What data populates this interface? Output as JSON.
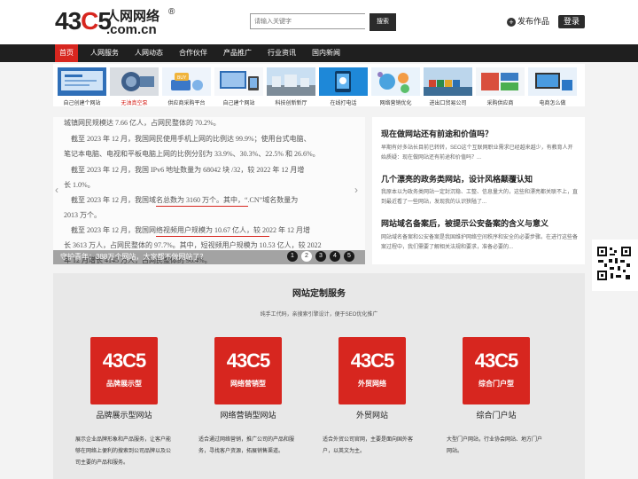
{
  "header": {
    "logo_digits": "43",
    "logo_mid": "C",
    "logo_end": "5",
    "logo_cn": "人网网络",
    "logo_domain": ".com.cn",
    "logo_reg": "®",
    "search_placeholder": "请输入关键字",
    "search_button": "搜索",
    "publish_label": "发布作品",
    "login_label": "登录"
  },
  "nav": [
    "首页",
    "人网服务",
    "人网动态",
    "合作伙伴",
    "产品推广",
    "行业资讯",
    "国内新闻"
  ],
  "thumbs": [
    {
      "caption": "自己创建个网站",
      "red": false
    },
    {
      "caption": "无油真空泵",
      "red": true
    },
    {
      "caption": "供应商采购平台",
      "red": false
    },
    {
      "caption": "自己建个网站",
      "red": false
    },
    {
      "caption": "科技创新新厅",
      "red": false
    },
    {
      "caption": "在线打电话",
      "red": false
    },
    {
      "caption": "网络营销优化",
      "red": false
    },
    {
      "caption": "进出口贸易公司",
      "red": false
    },
    {
      "caption": "采购供应商",
      "red": false
    },
    {
      "caption": "电商怎么做",
      "red": false
    }
  ],
  "slider": {
    "lines": [
      "城镇网民规模达 7.66 亿人，占网民整体的 70.2%。",
      "截至 2023 年 12 月，我国网民使用手机上网的比例达 99.9%；使用台式电脑、",
      "笔记本电脑、电视和平板电脑上网的比例分别为 33.9%、30.3%、22.5% 和 26.6%。",
      "截至 2023 年 12 月，我国 IPv6 地址数量为 68042 块 /32，较 2022 年 12 月增",
      "长 1.0%。",
      "截至 2023 年 12 月，我国域名总数为 3160 万个。其中，“.CN”域名数量为",
      "2013 万个。",
      "截至 2023 年 12 月，我国网络视频用户规模为 10.67 亿人，较 2022 年 12 月增",
      "长 3613 万人，占网民整体的 97.7%。其中，短视频用户规模为 10.53 亿人，较 2022",
      "年 12 月增长 4145 万人，占网民整体的 96.4%。"
    ],
    "caption": "守护青年：388万个网站，大家都不做网站了？",
    "dots": [
      "1",
      "2",
      "3",
      "4",
      "5"
    ],
    "active_dot": "2"
  },
  "news": [
    {
      "title": "现在做网站还有前途和价值吗？",
      "desc": "早期有好多站长目前已转转，SEO这个互联网职业需求已经越来越少，有教育人开始质疑：现在做网站还有前途和价值吗？..."
    },
    {
      "title": "几个漂亮的政务类网站，设计风格颠覆认知",
      "desc": "我原本以为政务类网站一定封沉稳、工整、信息量大的，这些和漂亮都关联不上，直到最近看了一些网站，发现我的认识狭隘了..."
    },
    {
      "title": "网站域名备案后，被提示公安备案的含义与意义",
      "desc": "网站域名备案和公安备案是我国维护网络空间秩序和安全的必要步骤。在进行这些备案过程中，我们需要了解相关法规和要求，准备必要的..."
    }
  ],
  "custom": {
    "title": "网站定制服务",
    "subtitle": "纯手工代码，亲搜索引擎设计，便于SEO优化推广",
    "cards": [
      {
        "logo": "43C5",
        "type": "品牌展示型",
        "title": "品牌展示型网站",
        "desc": "展示企业品牌形象和产品服务，让客户能够在网络上便利的搜索到公司品牌以及公司主要的产品和服务。"
      },
      {
        "logo": "43C5",
        "type": "网络营销型",
        "title": "网络营销型网站",
        "desc": "适合通过网络营销，推广公司的产品和服务，寻找客户资源，拓展销售渠道。"
      },
      {
        "logo": "43C5",
        "type": "外贸网络",
        "title": "外贸网站",
        "desc": "适合外贸公司官网，主要是面向国外客户，以英文为主。"
      },
      {
        "logo": "43C5",
        "type": "综合门户型",
        "title": "综合门户站",
        "desc": "大型门户网站，行业协会网站、地方门户网站。"
      }
    ]
  },
  "colors": {
    "accent": "#d7261f",
    "nav_bg": "#1f1f1f",
    "page_bg": "#f3f3f3"
  }
}
